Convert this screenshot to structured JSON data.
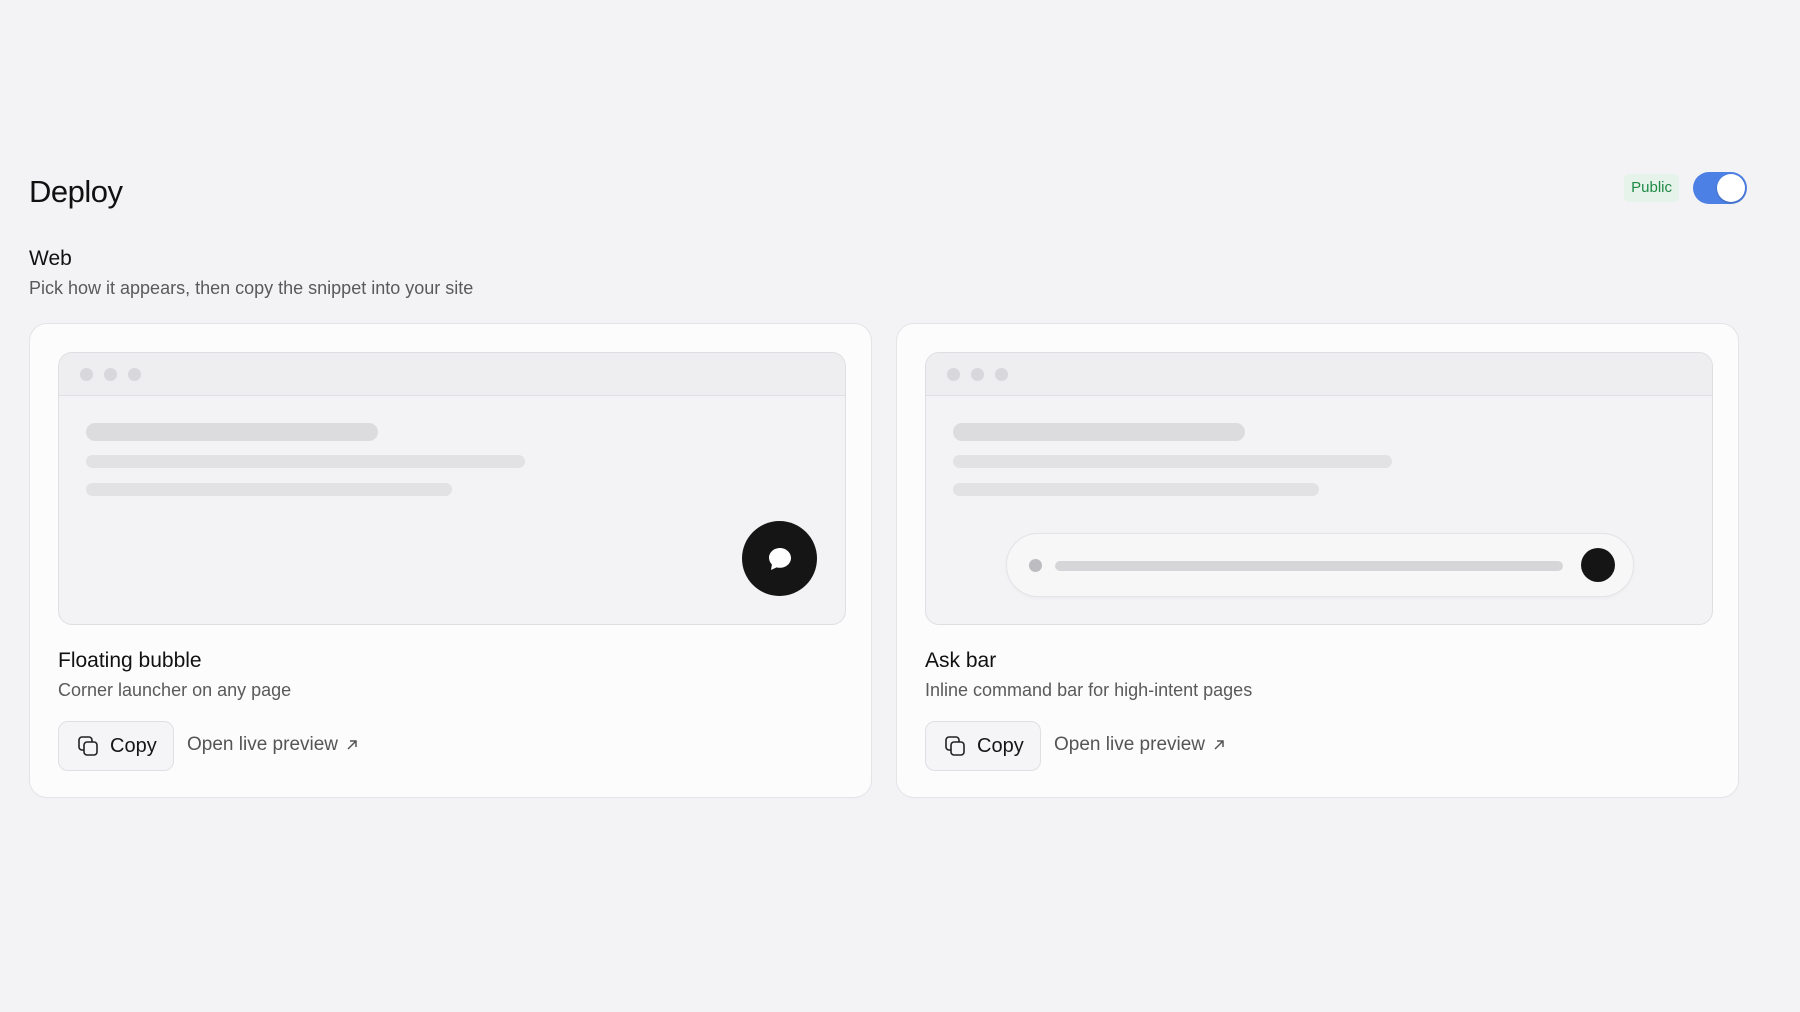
{
  "header": {
    "title": "Deploy",
    "visibility_badge": "Public",
    "public_toggle": {
      "on": true,
      "color": "#4d80e4"
    }
  },
  "section": {
    "title": "Web",
    "subtitle": "Pick how it appears, then copy the snippet into your site"
  },
  "cards": [
    {
      "title": "Floating bubble",
      "description": "Corner launcher on any page",
      "copy_label": "Copy",
      "preview_link": "Open live preview",
      "preview_icon": "chat-bubble-icon"
    },
    {
      "title": "Ask bar",
      "description": "Inline command bar for high-intent pages",
      "copy_label": "Copy",
      "preview_link": "Open live preview",
      "preview_icon": "ask-bar"
    }
  ],
  "colors": {
    "badge_text": "#1f8a46",
    "badge_bg": "#e6f3ea",
    "launcher": "#151515"
  }
}
